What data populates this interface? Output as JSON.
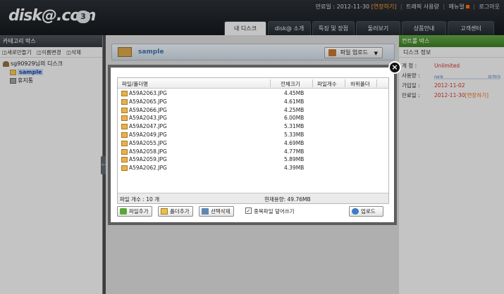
{
  "header": {
    "logo_text": "disk@.com",
    "logo_sub": "",
    "logo_badge": "3",
    "util": {
      "expire_label": "만료일 : 2012-11-30",
      "extend": "[연장하기]",
      "traffic": "트래픽 사용량",
      "menu": "메뉴얼",
      "logout": "로그아웃"
    },
    "nav": [
      {
        "label": "내 디스크",
        "active": true
      },
      {
        "label": "disk@ 소개",
        "active": false
      },
      {
        "label": "특징 및 장점",
        "active": false
      },
      {
        "label": "둘러보기",
        "active": false
      },
      {
        "label": "상품안내",
        "active": false
      },
      {
        "label": "고객센터",
        "active": false
      }
    ]
  },
  "left": {
    "title": "카테고리 박스",
    "tools": {
      "new_folder": "새로만들기",
      "rename": "이름변경",
      "delete": "삭제"
    },
    "tree": {
      "root": "sg90929님의 디스크",
      "sample": "sample",
      "trash": "휴지통"
    },
    "toggle": "<<"
  },
  "center": {
    "folder_name": "sample",
    "upload_button": "파일 업로드"
  },
  "right": {
    "title": "컨트롤 박스",
    "disk_title": "디스크 정보",
    "rows": {
      "account_label": "계   정 :",
      "account_value": "Unlimited",
      "usage_label": "사용량 :",
      "usage_used": "0KB",
      "usage_limit": "무한대",
      "join_label": "가입일 :",
      "join_value": "2012-11-02",
      "expire_label": "만료일 :",
      "expire_value": "2012-11-30",
      "expire_extra": "[연장하기]"
    }
  },
  "modal": {
    "close": "×",
    "columns": {
      "name": "파일/폴더명",
      "size": "전체크기",
      "count": "파일개수",
      "sub": "하위폴더"
    },
    "files": [
      {
        "name": "A59A2063.JPG",
        "size": "4.45MB"
      },
      {
        "name": "A59A2065.JPG",
        "size": "4.61MB"
      },
      {
        "name": "A59A2066.JPG",
        "size": "4.25MB"
      },
      {
        "name": "A59A2043.JPG",
        "size": "6.00MB"
      },
      {
        "name": "A59A2047.JPG",
        "size": "5.31MB"
      },
      {
        "name": "A59A2049.JPG",
        "size": "5.33MB"
      },
      {
        "name": "A59A2055.JPG",
        "size": "4.69MB"
      },
      {
        "name": "A59A2058.JPG",
        "size": "4.77MB"
      },
      {
        "name": "A59A2059.JPG",
        "size": "5.89MB"
      },
      {
        "name": "A59A2062.JPG",
        "size": "4.39MB"
      }
    ],
    "footer": {
      "count": "파일 개수 : 10 개",
      "total": "현재용량: 49.76MB"
    },
    "buttons": {
      "add_file": "파일추가",
      "add_folder": "폴더추가",
      "delete_selected": "선택삭제",
      "overwrite": "중복파일 덮어쓰기",
      "overwrite_check": "✓",
      "upload": "업로드"
    }
  }
}
